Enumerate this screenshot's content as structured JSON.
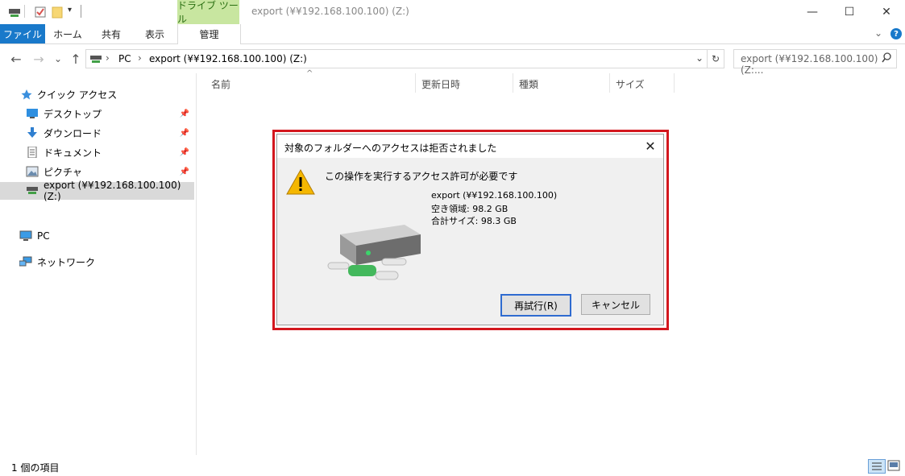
{
  "quick_access_toolbar": {
    "icons": [
      "network-drive-icon",
      "properties-check-icon",
      "new-folder-icon",
      "customize-dropdown-icon"
    ]
  },
  "ribbon": {
    "context_group_label": "ドライブ ツール",
    "tabs": [
      {
        "label": "ファイル"
      },
      {
        "label": "ホーム"
      },
      {
        "label": "共有"
      },
      {
        "label": "表示"
      },
      {
        "label": "管理"
      }
    ]
  },
  "window": {
    "title": "export (¥¥192.168.100.100) (Z:)",
    "minimize": "—",
    "maximize": "☐",
    "close": "✕"
  },
  "nav": {
    "back": "←",
    "forward": "→",
    "recent": "⌄",
    "up": "↑",
    "breadcrumb": [
      "PC",
      "export (¥¥192.168.100.100) (Z:)"
    ],
    "search_placeholder": "export (¥¥192.168.100.100) (Z:...",
    "refresh": "↻"
  },
  "sidebar": {
    "quick_access": "クイック アクセス",
    "items": [
      {
        "label": "デスクトップ",
        "pinned": true
      },
      {
        "label": "ダウンロード",
        "pinned": true
      },
      {
        "label": "ドキュメント",
        "pinned": true
      },
      {
        "label": "ピクチャ",
        "pinned": true
      },
      {
        "label": "export (¥¥192.168.100.100) (Z:)",
        "selected": true
      }
    ],
    "pc": "PC",
    "network": "ネットワーク"
  },
  "columns": [
    "名前",
    "更新日時",
    "種類",
    "サイズ"
  ],
  "status": {
    "item_count": "1 個の項目"
  },
  "dialog": {
    "title": "対象のフォルダーへのアクセスは拒否されました",
    "message": "この操作を実行するアクセス許可が必要です",
    "drive_name": "export (¥¥192.168.100.100)",
    "free_space": "空き領域: 98.2 GB",
    "total_size": "合計サイズ: 98.3 GB",
    "retry_label": "再試行(R)",
    "cancel_label": "キャンセル",
    "close": "✕"
  },
  "colors": {
    "accent": "#1979ca",
    "context_tab_bg": "#c8e6a0",
    "highlight_border": "#d3171e"
  }
}
